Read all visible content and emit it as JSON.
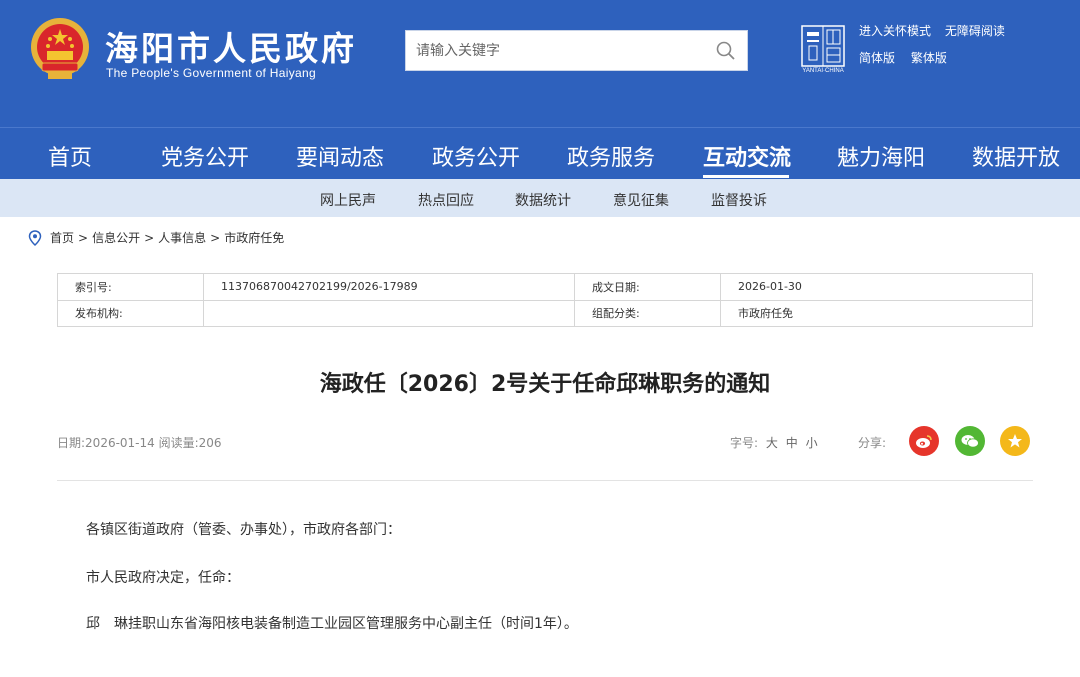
{
  "header": {
    "site_name": "海阳市人民政府",
    "site_name_en": "The People's Government of Haiyang",
    "search_placeholder": "请输入关键字",
    "seal_text": "YANTAI·CHINA",
    "links_row1": [
      "进入关怀模式",
      "无障碍阅读"
    ],
    "links_row2": [
      "简体版",
      "繁体版"
    ],
    "brand_color": "#2e61bd"
  },
  "nav": {
    "items": [
      "首页",
      "党务公开",
      "要闻动态",
      "政务公开",
      "政务服务",
      "互动交流",
      "魅力海阳",
      "数据开放"
    ],
    "active": "互动交流"
  },
  "subnav": {
    "items": [
      "网上民声",
      "热点回应",
      "数据统计",
      "意见征集",
      "监督投诉"
    ]
  },
  "breadcrumb": [
    "首页",
    "信息公开",
    "人事信息",
    "市政府任免"
  ],
  "info": {
    "index_label": "索引号:",
    "index_value": "113706870042702199/2026-17989",
    "date_label": "成文日期:",
    "date_value": "2026-01-30",
    "org_label": "发布机构:",
    "org_value": "",
    "category_label": "组配分类:",
    "category_value": "市政府任免"
  },
  "article": {
    "title": "海政任〔2026〕2号关于任命邱琳职务的通知",
    "meta": "日期:2026-01-14 阅读量:206",
    "fontsize_label": "字号:",
    "fontsizes": [
      "大",
      "中",
      "小"
    ],
    "share_label": "分享:",
    "share_icons": [
      "weibo-icon",
      "wechat-icon",
      "star-icon"
    ],
    "share_colors": [
      "#e6352b",
      "#52b734",
      "#f4b81a"
    ],
    "paragraphs": [
      "各镇区街道政府（管委、办事处），市政府各部门：",
      "市人民政府决定，任命：",
      "邱　琳挂职山东省海阳核电装备制造工业园区管理服务中心副主任（时间1年）。"
    ]
  }
}
